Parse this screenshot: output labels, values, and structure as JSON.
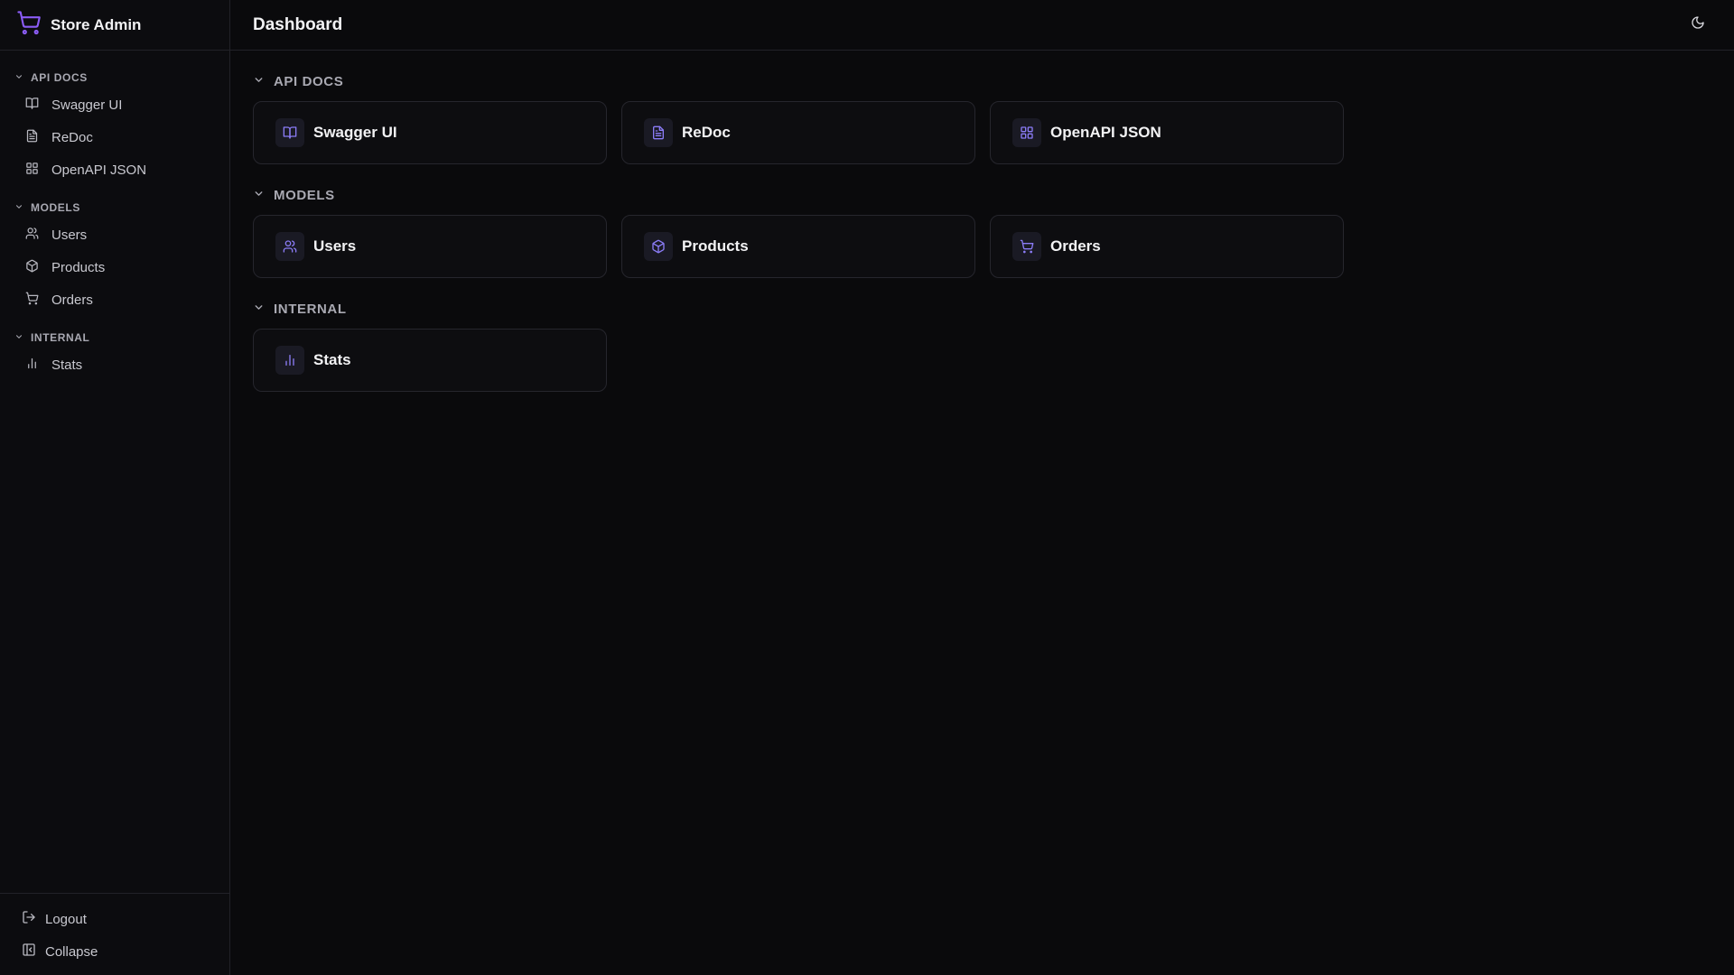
{
  "app": {
    "title": "Store Admin"
  },
  "colors": {
    "accent": "#8b5cf6",
    "background": "#0a0a0c",
    "border": "#222228"
  },
  "sidebar": {
    "sections": [
      {
        "label": "API DOCS",
        "items": [
          {
            "label": "Swagger UI",
            "icon": "book-open-icon"
          },
          {
            "label": "ReDoc",
            "icon": "file-text-icon"
          },
          {
            "label": "OpenAPI JSON",
            "icon": "layout-grid-icon"
          }
        ]
      },
      {
        "label": "MODELS",
        "items": [
          {
            "label": "Users",
            "icon": "users-icon"
          },
          {
            "label": "Products",
            "icon": "package-icon"
          },
          {
            "label": "Orders",
            "icon": "shopping-cart-icon"
          }
        ]
      },
      {
        "label": "INTERNAL",
        "items": [
          {
            "label": "Stats",
            "icon": "bar-chart-icon"
          }
        ]
      }
    ],
    "footer": {
      "logout_label": "Logout",
      "collapse_label": "Collapse"
    }
  },
  "header": {
    "title": "Dashboard",
    "theme_icon": "moon-icon"
  },
  "main": {
    "sections": [
      {
        "label": "API DOCS",
        "cards": [
          {
            "label": "Swagger UI",
            "icon": "book-open-icon"
          },
          {
            "label": "ReDoc",
            "icon": "file-text-icon"
          },
          {
            "label": "OpenAPI JSON",
            "icon": "layout-grid-icon"
          }
        ]
      },
      {
        "label": "MODELS",
        "cards": [
          {
            "label": "Users",
            "icon": "users-icon"
          },
          {
            "label": "Products",
            "icon": "package-icon"
          },
          {
            "label": "Orders",
            "icon": "shopping-cart-icon"
          }
        ]
      },
      {
        "label": "INTERNAL",
        "cards": [
          {
            "label": "Stats",
            "icon": "bar-chart-icon"
          }
        ]
      }
    ]
  }
}
